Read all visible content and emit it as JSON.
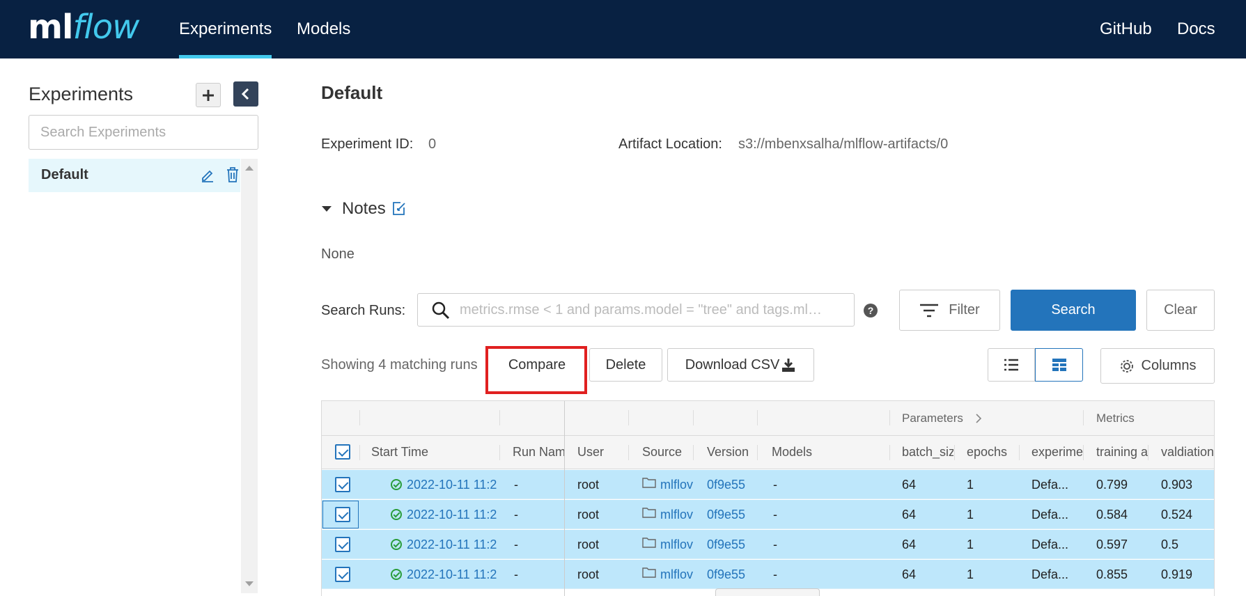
{
  "header": {
    "logo_ml": "ml",
    "logo_flow": "flow",
    "nav": [
      "Experiments",
      "Models"
    ],
    "right_links": [
      "GitHub",
      "Docs"
    ]
  },
  "sidebar": {
    "title": "Experiments",
    "search_placeholder": "Search Experiments",
    "items": [
      {
        "label": "Default"
      }
    ]
  },
  "main": {
    "title": "Default",
    "experiment_id_label": "Experiment ID:",
    "experiment_id": "0",
    "artifact_label": "Artifact Location:",
    "artifact_value": "s3://mbenxsalha/mlflow-artifacts/0",
    "notes_label": "Notes",
    "notes_value": "None",
    "search_label": "Search Runs:",
    "search_placeholder": "metrics.rmse < 1 and params.model = \"tree\" and tags.ml…",
    "filter_label": "Filter",
    "search_button": "Search",
    "clear_button": "Clear",
    "showing_text": "Showing 4 matching runs",
    "compare_button": "Compare",
    "delete_button": "Delete",
    "download_button": "Download CSV",
    "columns_button": "Columns"
  },
  "table": {
    "groups": {
      "parameters": "Parameters",
      "metrics": "Metrics"
    },
    "headers": [
      "Start Time",
      "Run Nam",
      "User",
      "Source",
      "Version",
      "Models",
      "batch_siz",
      "epochs",
      "experime",
      "training a",
      "valdiation"
    ],
    "rows": [
      {
        "start": "2022-10-11 11:2",
        "run_name": "-",
        "user": "root",
        "source": "mlflov",
        "version": "0f9e55",
        "models": "-",
        "batch_size": "64",
        "epochs": "1",
        "experiment": "Defa...",
        "training": "0.799",
        "validation": "0.903"
      },
      {
        "start": "2022-10-11 11:2",
        "run_name": "-",
        "user": "root",
        "source": "mlflov",
        "version": "0f9e55",
        "models": "-",
        "batch_size": "64",
        "epochs": "1",
        "experiment": "Defa...",
        "training": "0.584",
        "validation": "0.524"
      },
      {
        "start": "2022-10-11 11:2",
        "run_name": "-",
        "user": "root",
        "source": "mlflov",
        "version": "0f9e55",
        "models": "-",
        "batch_size": "64",
        "epochs": "1",
        "experiment": "Defa...",
        "training": "0.597",
        "validation": "0.5"
      },
      {
        "start": "2022-10-11 11:2",
        "run_name": "-",
        "user": "root",
        "source": "mlflov",
        "version": "0f9e55",
        "models": "-",
        "batch_size": "64",
        "epochs": "1",
        "experiment": "Defa...",
        "training": "0.855",
        "validation": "0.919"
      }
    ]
  },
  "colors": {
    "header_bg": "#082142",
    "accent": "#43c9ed",
    "primary": "#2374bb",
    "row_selected": "#bee7fb",
    "highlight": "#e02020"
  }
}
